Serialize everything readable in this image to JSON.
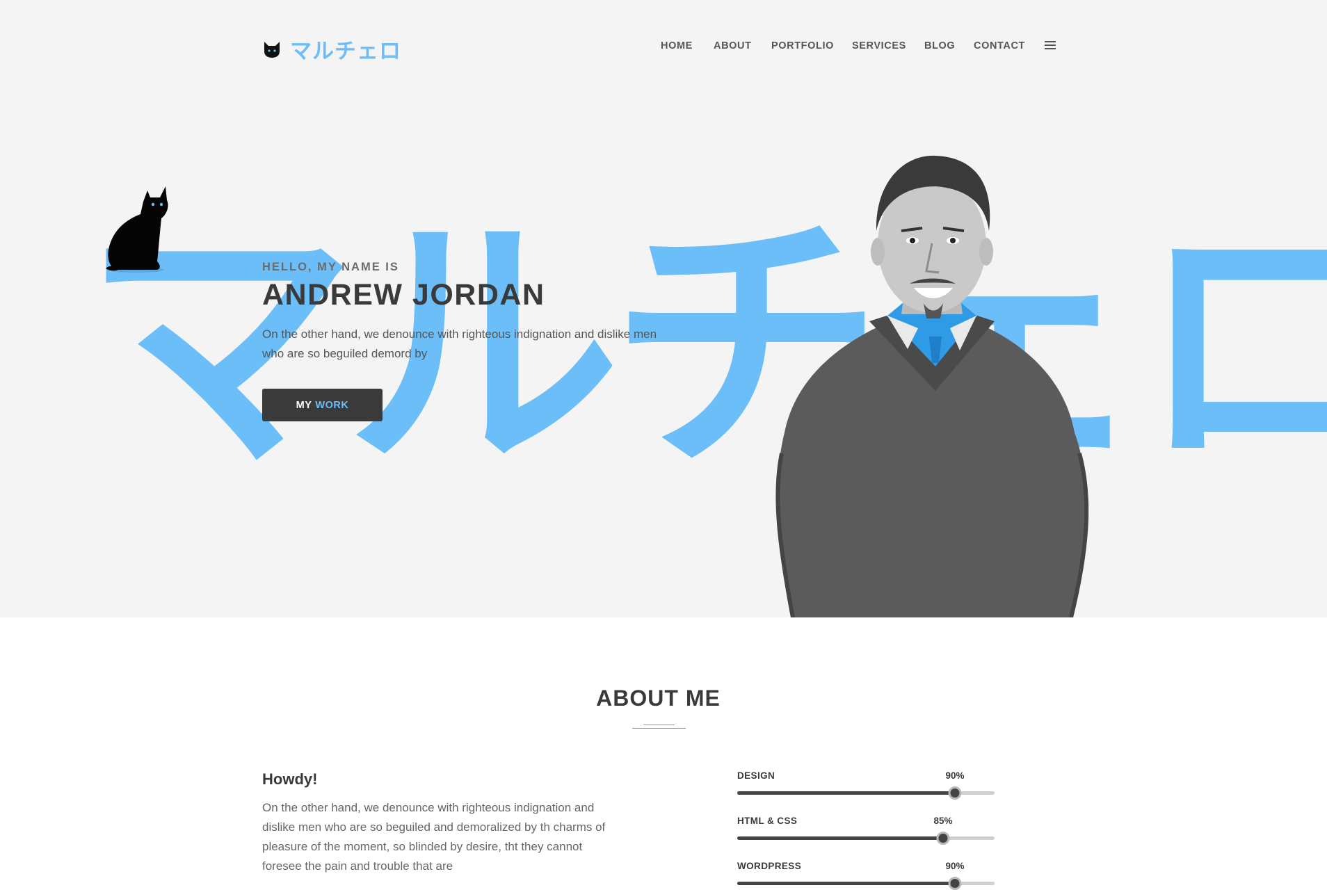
{
  "brand": {
    "logo_text": "マルチェロ"
  },
  "nav": {
    "items": [
      "HOME",
      "ABOUT",
      "PORTFOLIO",
      "SERVICES",
      "BLOG",
      "CONTACT"
    ],
    "menu_icon": "hamburger-icon"
  },
  "hero": {
    "background_text": "マルチェロ",
    "eyebrow": "HELLO, MY NAME IS",
    "name": "ANDREW JORDAN",
    "description": "On the other hand, we denounce with righteous indignation and dislike men who are so beguiled demord by",
    "button": {
      "word1": "MY",
      "word2": "WORK"
    }
  },
  "about": {
    "title": "ABOUT ME",
    "heading": "Howdy!",
    "body": "On the other hand, we denounce with righteous indignation and dislike men who are so beguiled and demoralized by th charms of pleasure of the moment, so blinded by desire, tht they cannot foresee the pain and trouble that are",
    "skills": [
      {
        "name": "DESIGN",
        "percent_label": "90%",
        "level": 0.9
      },
      {
        "name": "HTML & CSS",
        "percent_label": "85%",
        "level": 0.85
      },
      {
        "name": "WORDPRESS",
        "percent_label": "90%",
        "level": 0.9
      }
    ]
  },
  "colors": {
    "accent": "#6bbef7",
    "dark": "#3a3a3b",
    "hero_bg": "#f4f4f5"
  }
}
